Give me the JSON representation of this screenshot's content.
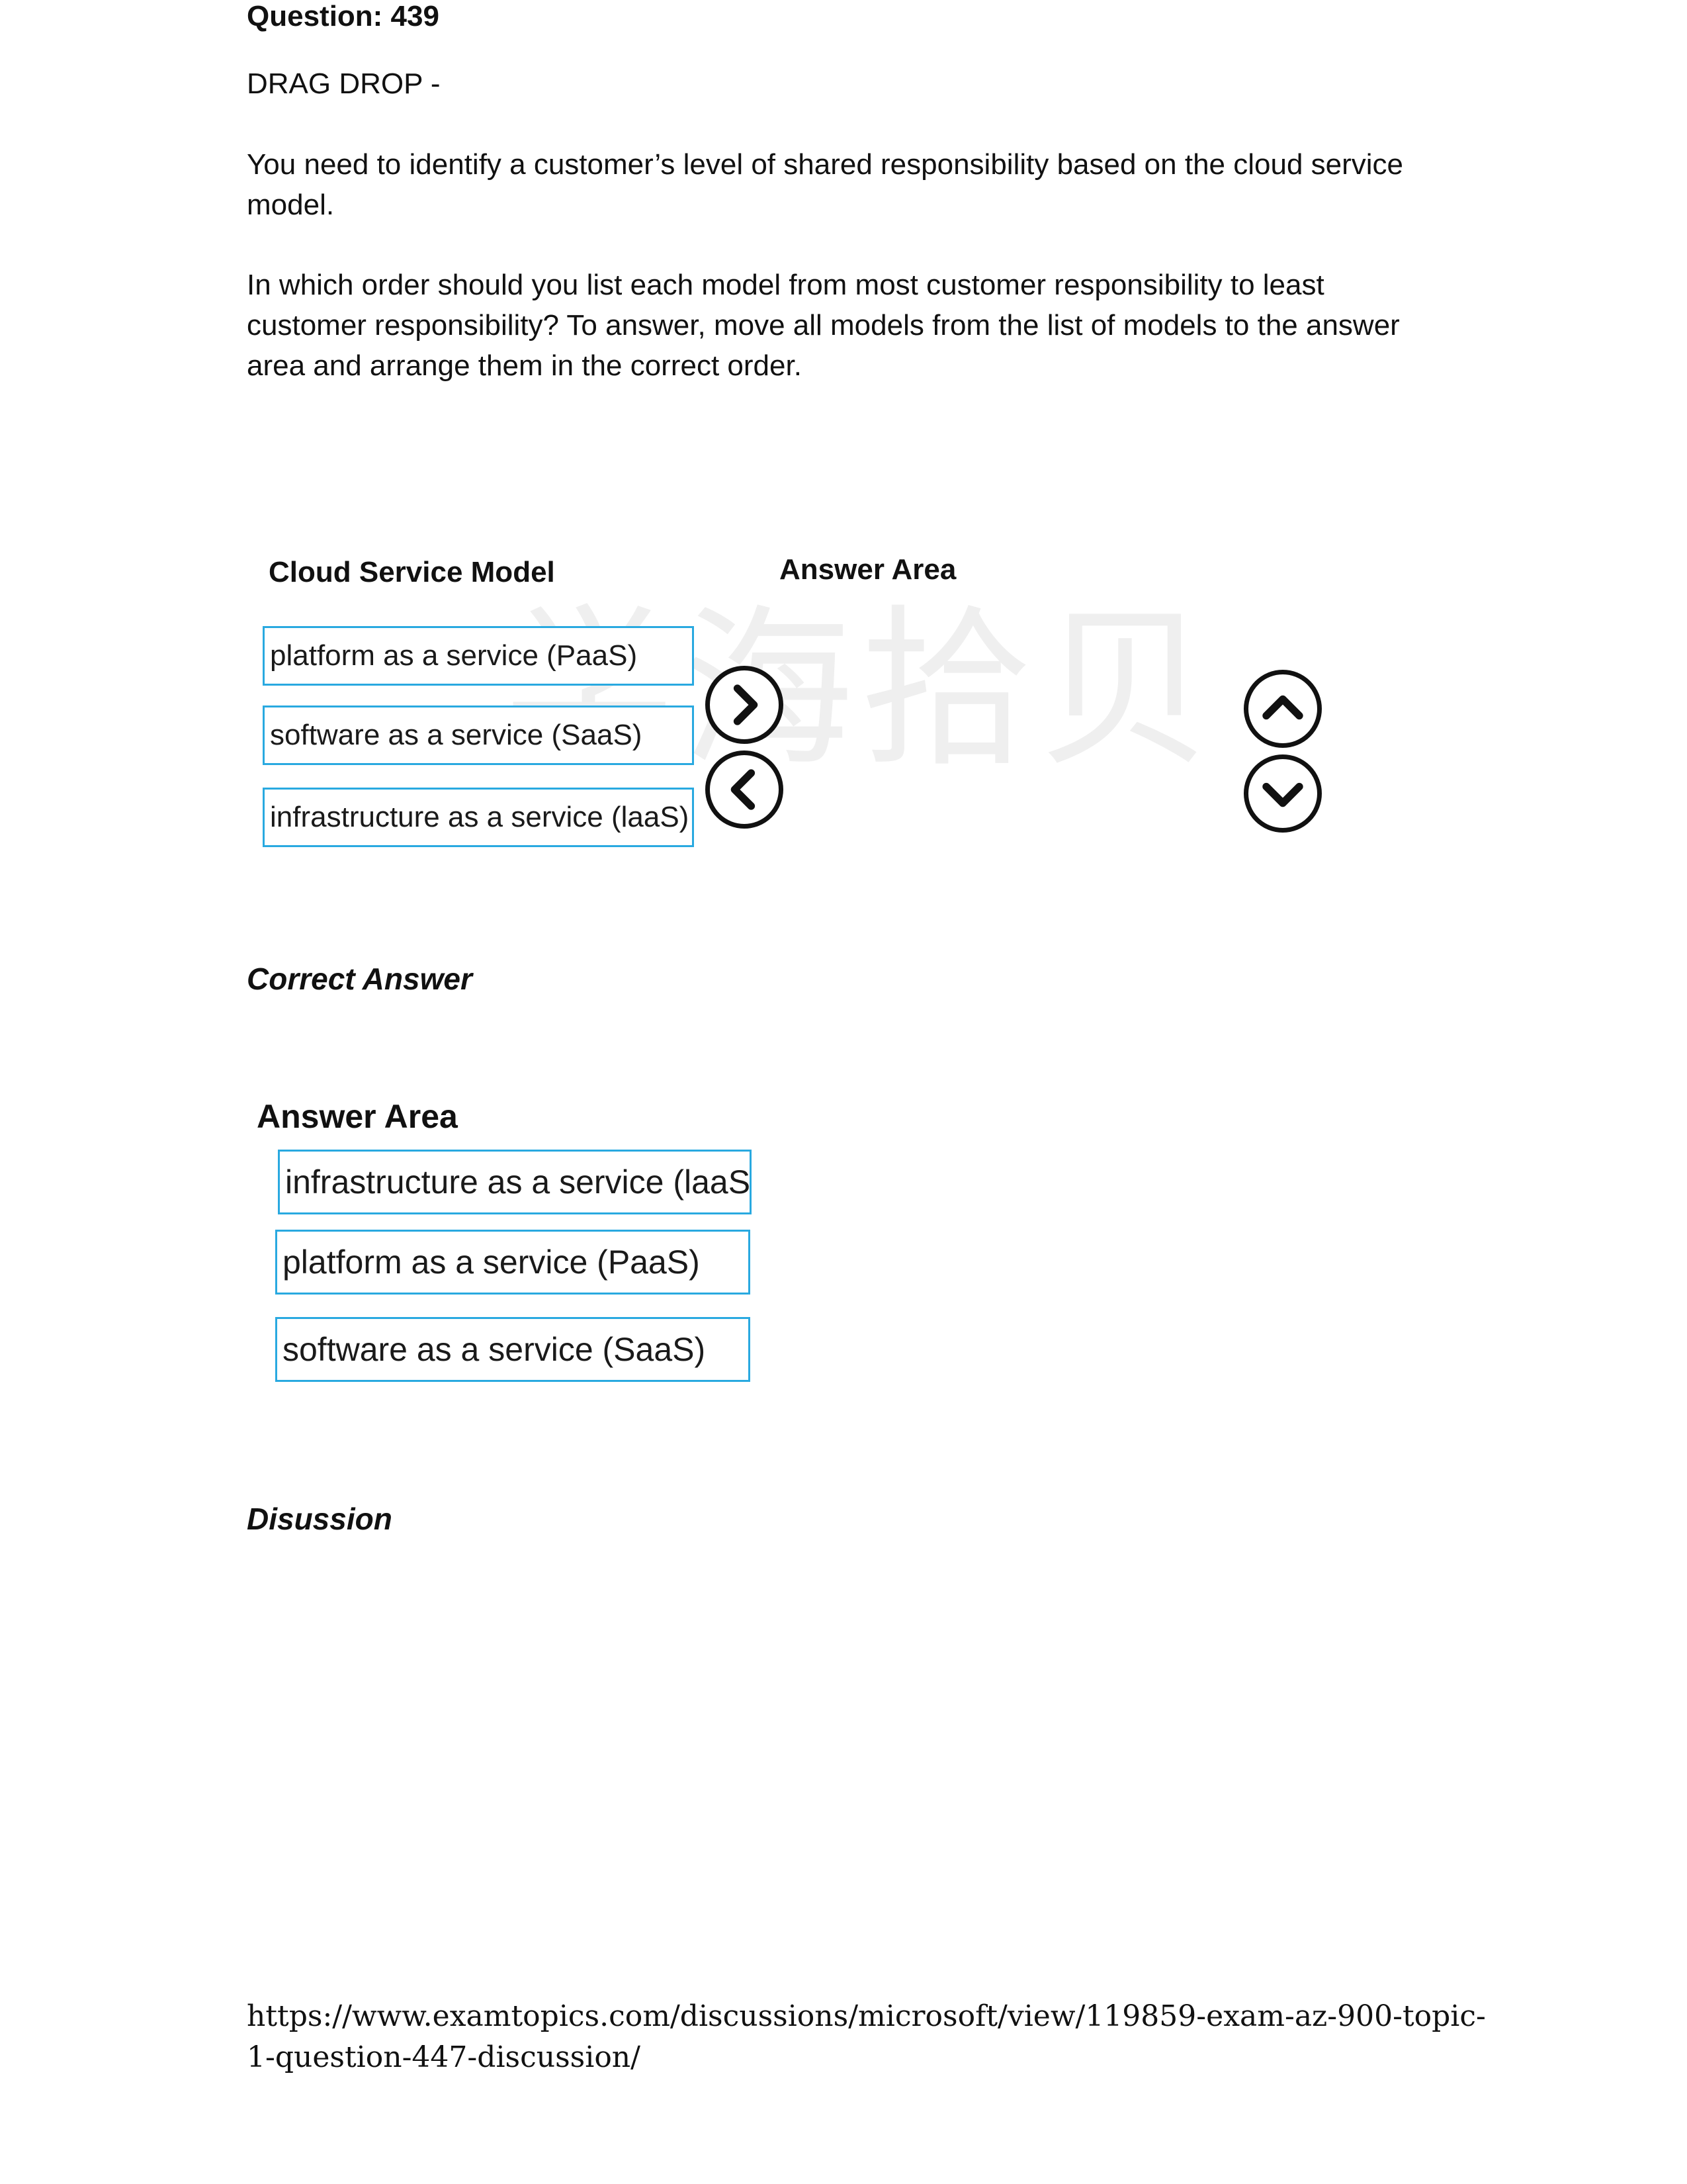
{
  "question": {
    "title": "Question: 439",
    "type": "DRAG DROP -",
    "prompt": "You need to identify a customer’s level of shared responsibility based on the cloud service model.",
    "instruction": "In which order should you list each model from most customer responsibility to least customer responsibility? To answer, move all models from the list of models to the answer area and arrange them in the correct order."
  },
  "drag_area": {
    "source_heading": "Cloud Service Model",
    "answer_heading": "Answer Area",
    "options": [
      "platform as a service (PaaS)",
      "software as a service (SaaS)",
      "infrastructure as a service (laaS)"
    ],
    "watermark": "学海拾贝"
  },
  "correct_answer": {
    "heading": "Correct Answer",
    "answer_heading": "Answer Area",
    "items": [
      "infrastructure as a service (laaS)",
      "platform as a service (PaaS)",
      "software as a service (SaaS)"
    ]
  },
  "discussion": {
    "heading": "Disussion"
  },
  "footer": {
    "url": "https://www.examtopics.com/discussions/microsoft/view/119859-exam-az-900-topic-1-question-447-discussion/"
  },
  "colors": {
    "box_border": "#29a9e0",
    "text": "#111111"
  },
  "icons": [
    "move-right-icon",
    "move-left-icon",
    "move-up-icon",
    "move-down-icon"
  ]
}
